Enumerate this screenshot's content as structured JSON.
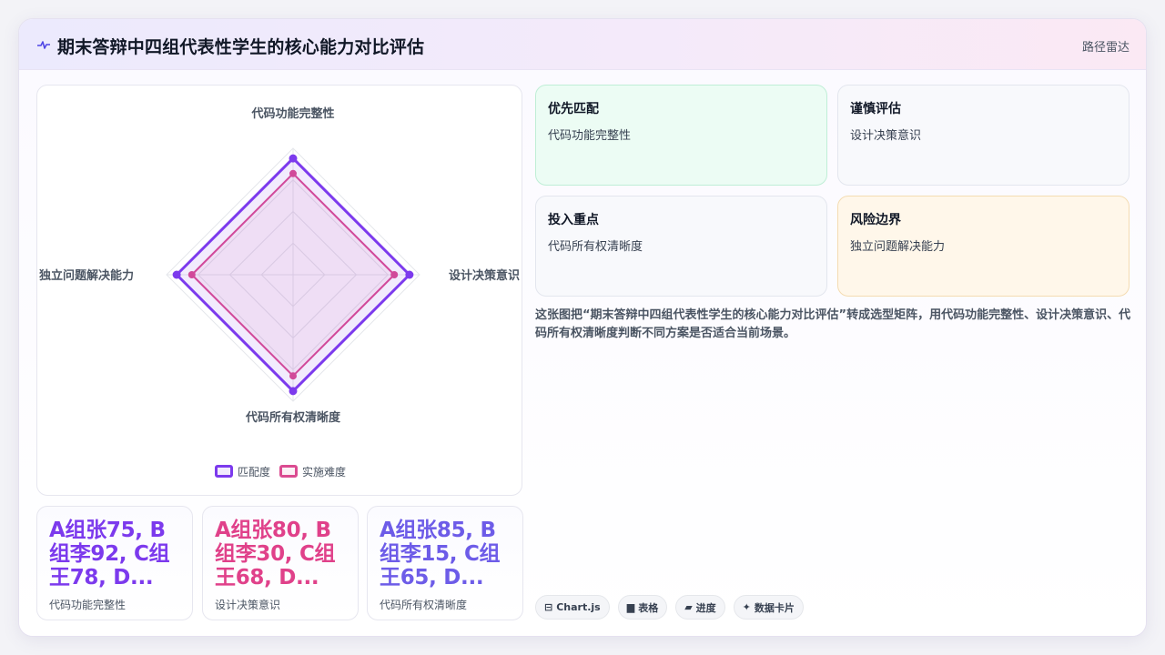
{
  "header": {
    "title": "期末答辩中四组代表性学生的核心能力对比评估",
    "tag": "路径雷达",
    "icon": "pulse-line-icon"
  },
  "chart_data": {
    "type": "radar",
    "axes": [
      "代码功能完整性",
      "设计决策意识",
      "代码所有权清晰度",
      "独立问题解决能力"
    ],
    "series": [
      {
        "name": "匹配度",
        "values": [
          92,
          92,
          92,
          92
        ],
        "color": "#7c3aed"
      },
      {
        "name": "实施难度",
        "values": [
          80,
          80,
          80,
          80
        ],
        "color": "#db4b91"
      }
    ],
    "range": [
      0,
      100
    ],
    "rings": 4,
    "legend_position": "bottom"
  },
  "stats": [
    {
      "value": "A组张75, B组李92, C组王78, D...",
      "label": "代码功能完整性",
      "color": "#7c3aed"
    },
    {
      "value": "A组张80, B组李30, C组王68, D...",
      "label": "设计决策意识",
      "color": "#e0418a"
    },
    {
      "value": "A组张85, B组李15, C组王65, D...",
      "label": "代码所有权清晰度",
      "color": "#6d5ce8"
    }
  ],
  "tiles": [
    {
      "title": "优先匹配",
      "sub": "代码功能完整性",
      "bg": "#ecfcf4",
      "border": "#bfeed6"
    },
    {
      "title": "谨慎评估",
      "sub": "设计决策意识",
      "bg": "#f8f9fc",
      "border": "#e3e6ee"
    },
    {
      "title": "投入重点",
      "sub": "代码所有权清晰度",
      "bg": "#f8f9fc",
      "border": "#e3e6ee"
    },
    {
      "title": "风险边界",
      "sub": "独立问题解决能力",
      "bg": "#fff7ea",
      "border": "#f4dcb2"
    }
  ],
  "description": "这张图把“期末答辩中四组代表性学生的核心能力对比评估”转成选型矩阵，用代码功能完整性、设计决策意识、代码所有权清晰度判断不同方案是否适合当前场景。",
  "chips": [
    {
      "icon": "⊟",
      "label": "Chart.js",
      "icon_name": "chart-icon"
    },
    {
      "icon": "▆",
      "label": "表格",
      "icon_name": "table-icon"
    },
    {
      "icon": "▰",
      "label": "进度",
      "icon_name": "progress-icon"
    },
    {
      "icon": "✦",
      "label": "数据卡片",
      "icon_name": "sparkle-icon"
    }
  ]
}
